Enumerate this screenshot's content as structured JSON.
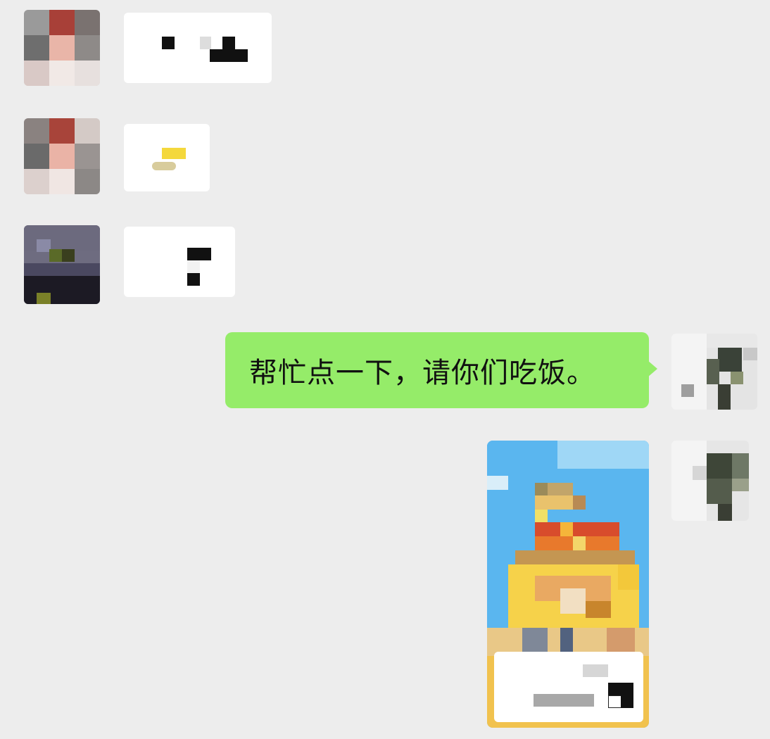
{
  "messages": [
    {
      "direction": "incoming",
      "type": "text",
      "redacted": true
    },
    {
      "direction": "incoming",
      "type": "sticker",
      "redacted": true
    },
    {
      "direction": "incoming",
      "type": "text",
      "redacted": true
    },
    {
      "direction": "outgoing",
      "type": "text",
      "text": "帮忙点一下，请你们吃饭。"
    },
    {
      "direction": "outgoing",
      "type": "mini-program-card",
      "redacted": true
    }
  ],
  "colors": {
    "background": "#ededed",
    "incoming_bubble": "#ffffff",
    "outgoing_bubble": "#95ec69",
    "text": "#111111",
    "card_sky": "#5ab6ef",
    "card_banner": "#f6d24a"
  },
  "icons": [
    "avatar-image",
    "pixelated-avatar",
    "mini-program-thumbnail"
  ]
}
